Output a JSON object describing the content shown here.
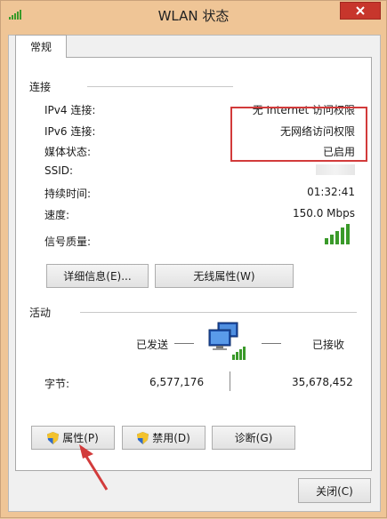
{
  "window": {
    "title": "WLAN 状态"
  },
  "tabs": [
    {
      "label": "常规"
    }
  ],
  "connection": {
    "heading": "连接",
    "rows": [
      {
        "label": "IPv4 连接:",
        "value": "无 Internet 访问权限"
      },
      {
        "label": "IPv6 连接:",
        "value": "无网络访问权限"
      },
      {
        "label": "媒体状态:",
        "value": "已启用"
      },
      {
        "label": "SSID:",
        "value": ""
      },
      {
        "label": "持续时间:",
        "value": "01:32:41"
      },
      {
        "label": "速度:",
        "value": "150.0 Mbps"
      },
      {
        "label": "信号质量:",
        "value": ""
      }
    ],
    "signal_level_bars": 5,
    "details_button": "详细信息(E)...",
    "wireless_props_button": "无线属性(W)"
  },
  "activity": {
    "heading": "活动",
    "sent_label": "已发送",
    "received_label": "已接收",
    "bytes_label": "字节:",
    "bytes_sent": "6,577,176",
    "bytes_received": "35,678,452"
  },
  "buttons": {
    "properties": "属性(P)",
    "disable": "禁用(D)",
    "diagnose": "诊断(G)",
    "close": "关闭(C)"
  },
  "colors": {
    "title_bar": "#efc596",
    "close_button": "#c7362c",
    "highlight": "#d23b3b",
    "signal": "#3a9a2a"
  },
  "icons": {
    "title": "wifi-signal-icon",
    "close": "close-icon",
    "network": "network-computers-icon",
    "shield": "uac-shield-icon",
    "annotation": "red-arrow-icon"
  }
}
